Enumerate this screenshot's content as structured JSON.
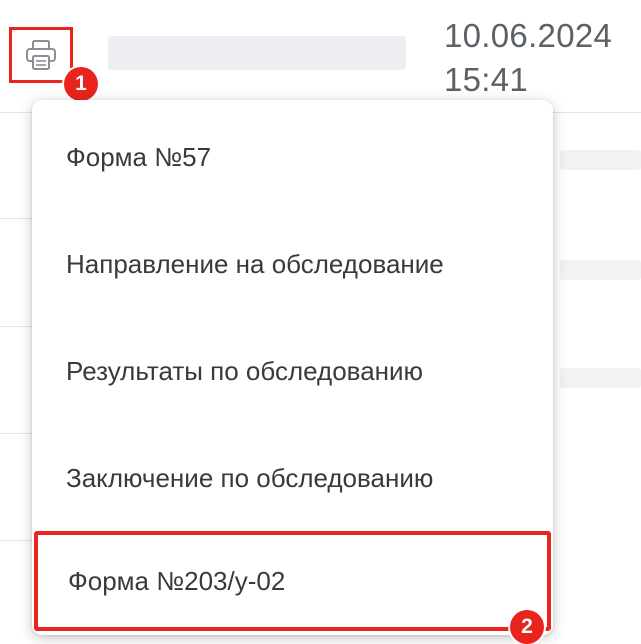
{
  "header": {
    "date": "10.06.2024",
    "time": "15:41",
    "print_icon": "printer-icon"
  },
  "annotations": {
    "badge_1": "1",
    "badge_2": "2",
    "highlight_color": "#e8241c"
  },
  "print_menu": {
    "items": [
      {
        "label": "Форма №57"
      },
      {
        "label": "Направление на обследование"
      },
      {
        "label": "Результаты по обследованию"
      },
      {
        "label": "Заключение по обследованию"
      },
      {
        "label": "Форма №203/у-02",
        "highlighted": true
      }
    ]
  }
}
